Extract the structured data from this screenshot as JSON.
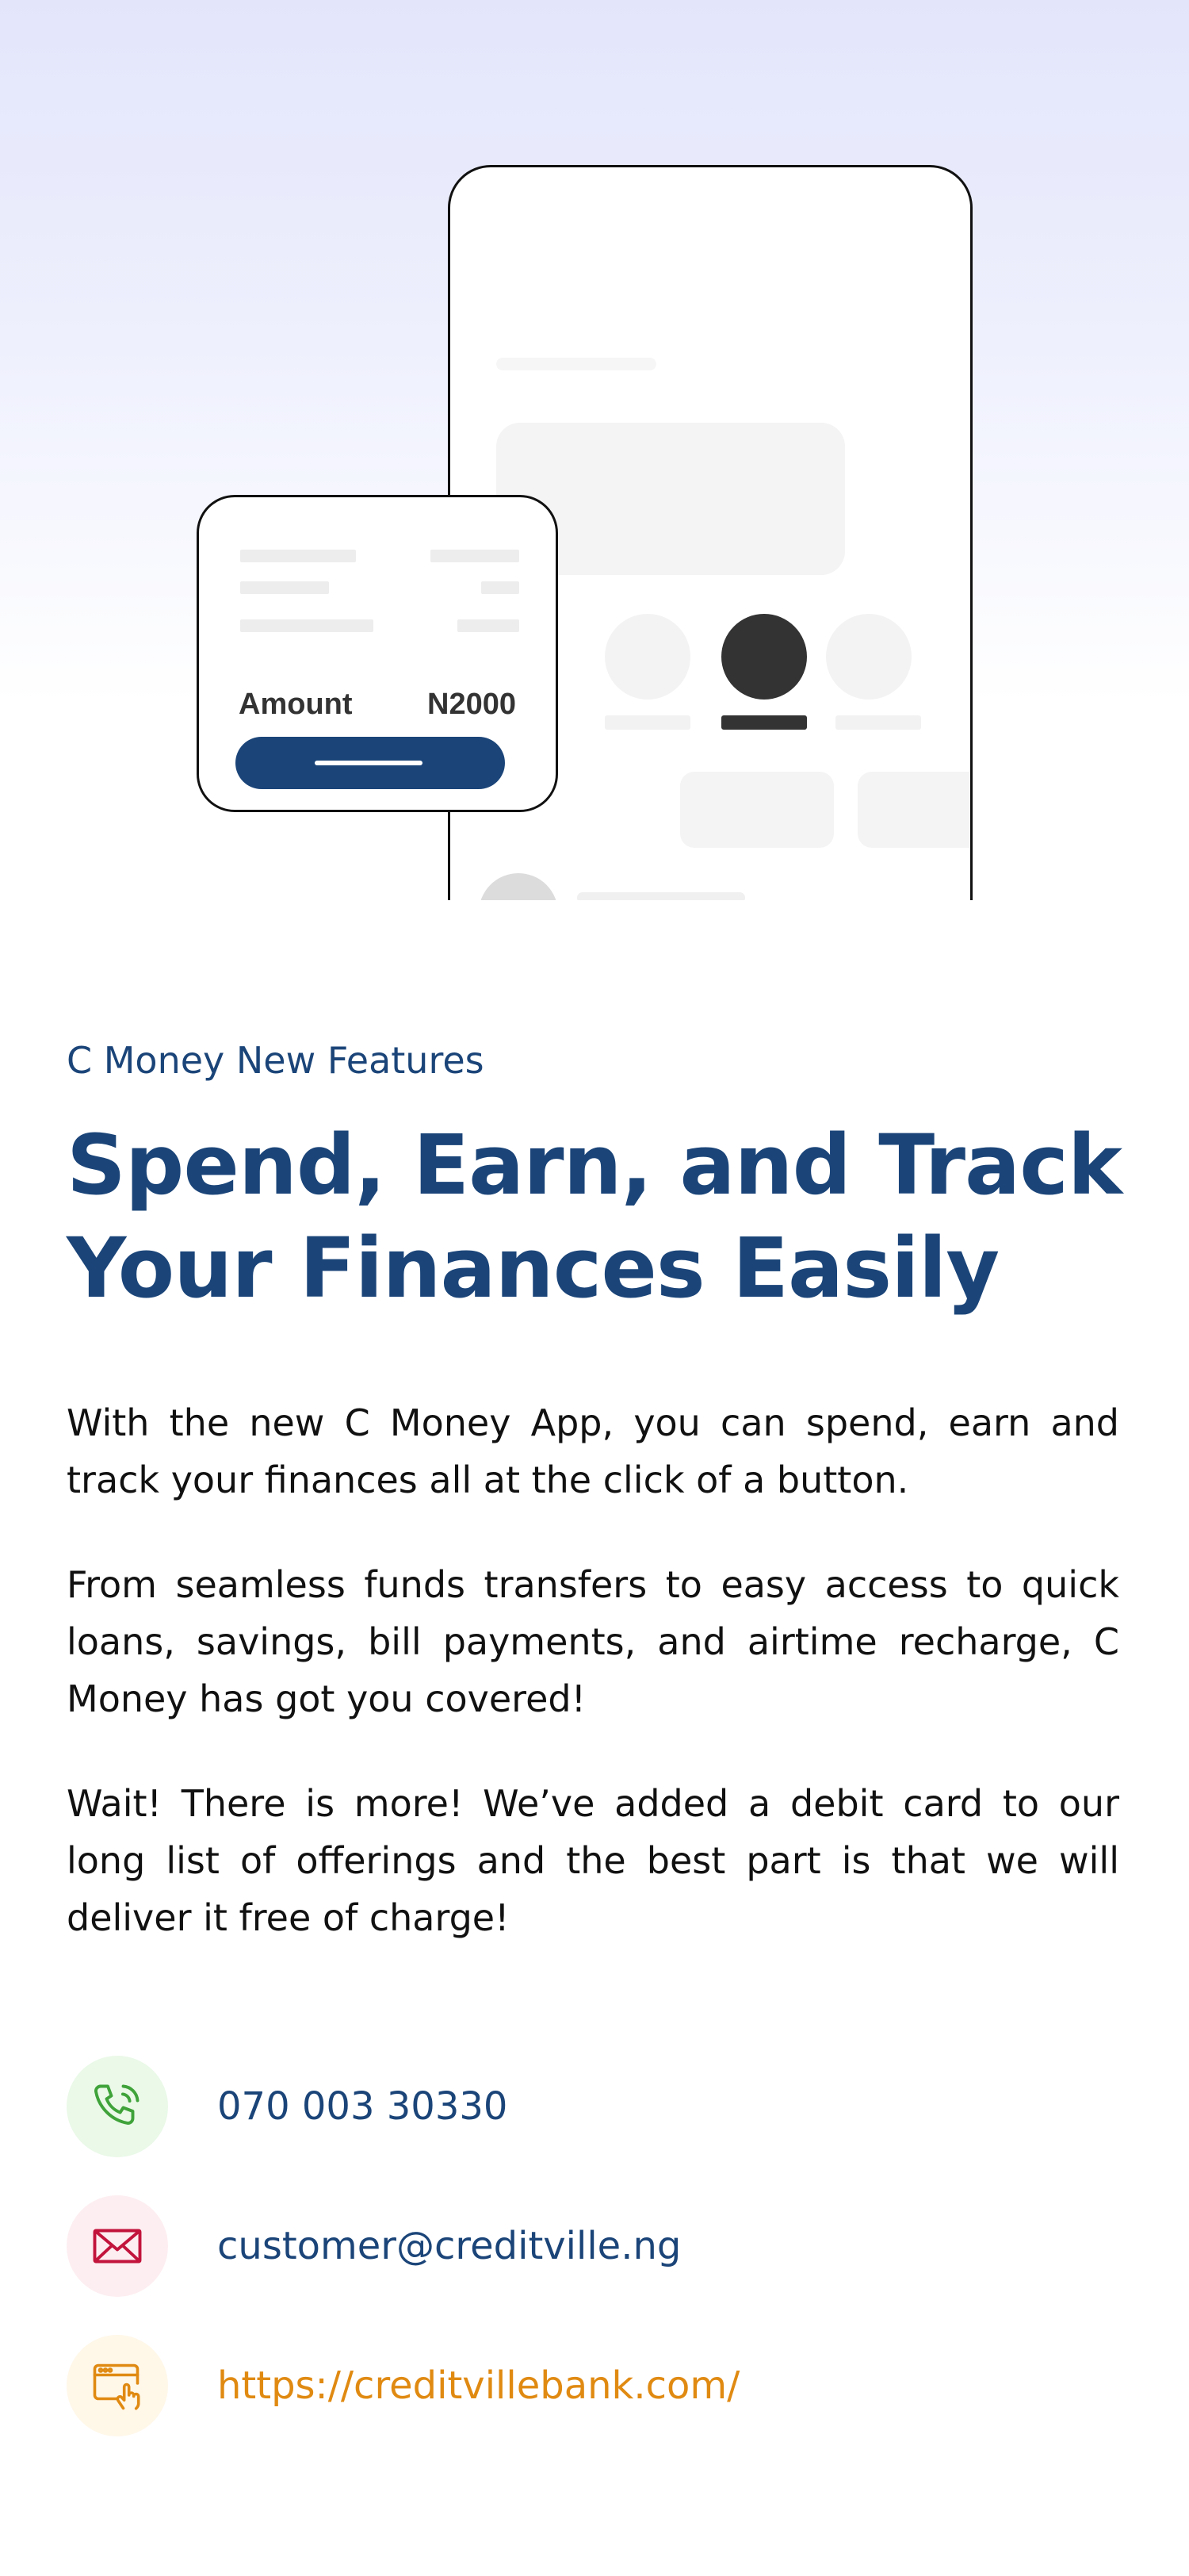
{
  "illustration": {
    "card": {
      "amount_label": "Amount",
      "amount_value": "N2000"
    },
    "colors": {
      "button": "#1b4579",
      "selected_tab": "#333333"
    }
  },
  "content": {
    "eyebrow": "C Money New Features",
    "headline_line1": "Spend, Earn, and Track",
    "headline_line2": "Your Finances Easily",
    "paragraphs": [
      "With the new C Money App, you can spend, earn and track your finances all at the click of a button.",
      "From seamless funds transfers to easy access to quick loans, savings, bill payments, and airtime recharge, C Money has got you covered!",
      "Wait! There is more! We’ve added a debit card to our long list of offerings and the best part is that we will deliver it free of charge!"
    ]
  },
  "contacts": {
    "phone": {
      "icon": "phone-icon",
      "text": "070 003 30330",
      "color": "#1b4579",
      "bg": "#eaf9e8",
      "icon_color": "#3fa33a"
    },
    "email": {
      "icon": "mail-icon",
      "text": "customer@creditville.ng",
      "color": "#1b4579",
      "bg": "#fdeef1",
      "icon_color": "#c2143c"
    },
    "website": {
      "icon": "web-click-icon",
      "text": "https://creditvillebank.com/",
      "color": "#e08a12",
      "bg": "#fff7e8",
      "icon_color": "#e08a12"
    }
  }
}
